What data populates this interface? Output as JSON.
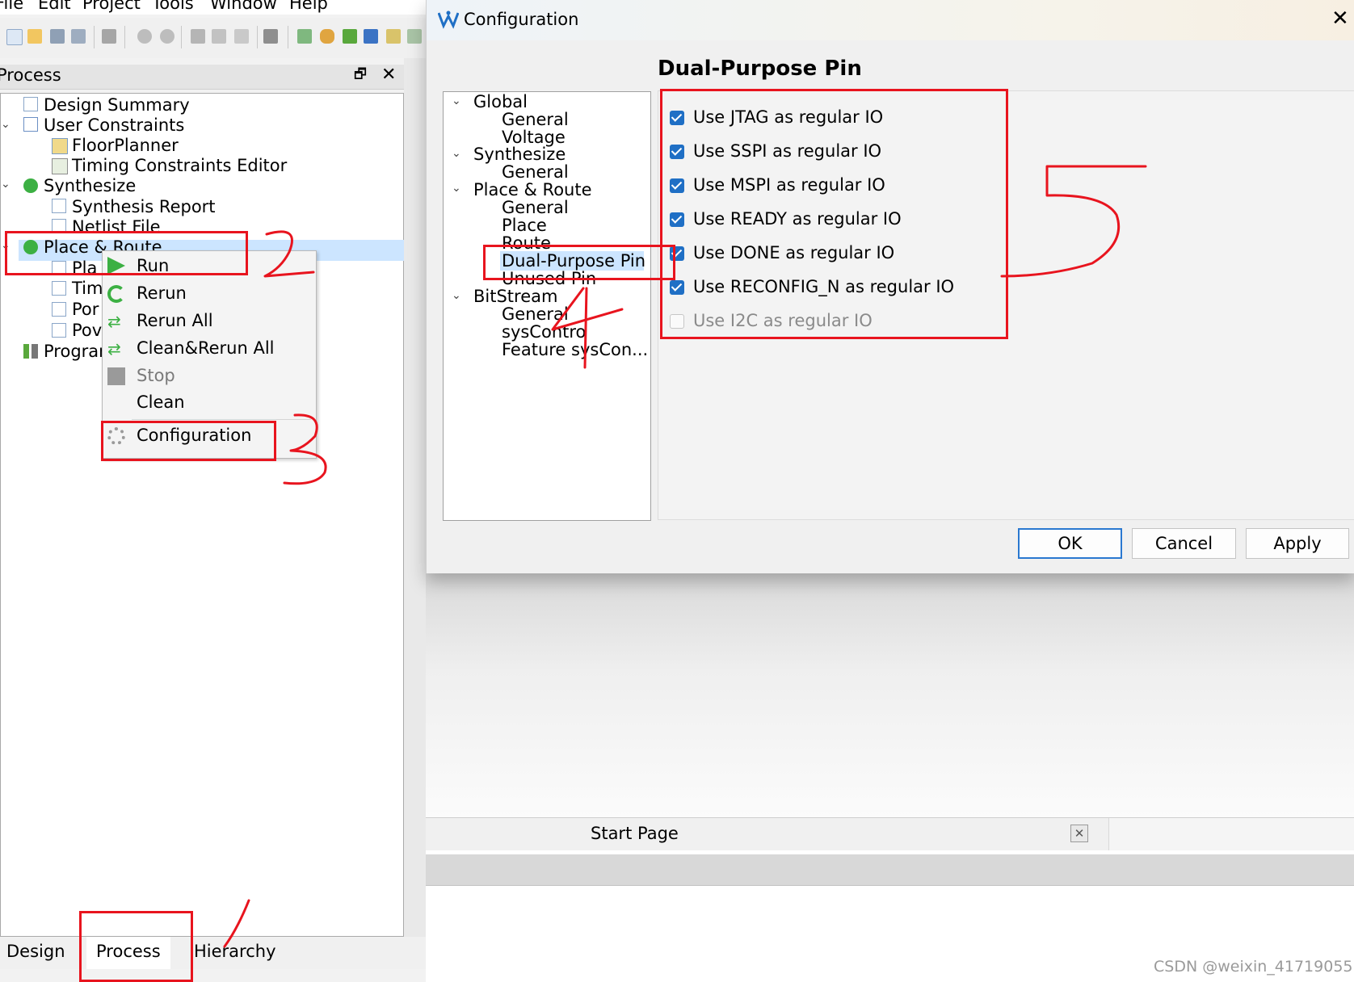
{
  "menubar": {
    "items": [
      "File",
      "Edit",
      "Project",
      "Tools",
      "Window",
      "Help"
    ]
  },
  "process_panel": {
    "title": "Process",
    "tree": {
      "design_summary": "Design Summary",
      "user_constraints": "User Constraints",
      "floorplanner": "FloorPlanner",
      "timing_editor": "Timing Constraints Editor",
      "synthesize": "Synthesize",
      "synthesis_report": "Synthesis Report",
      "netlist_file": "Netlist File",
      "place_route": "Place & Route",
      "pr_child_1": "Pla",
      "pr_child_2": "Tim",
      "pr_child_3": "Por",
      "pr_child_4": "Pov",
      "program": "Program"
    }
  },
  "context_menu": {
    "run": "Run",
    "rerun": "Rerun",
    "rerun_all": "Rerun All",
    "clean_rerun_all": "Clean&Rerun All",
    "stop": "Stop",
    "clean": "Clean",
    "configuration": "Configuration"
  },
  "bottom_tabs": {
    "design": "Design",
    "process": "Process",
    "hierarchy": "Hierarchy"
  },
  "dialog": {
    "title": "Configuration",
    "heading": "Dual-Purpose Pin",
    "tree": {
      "global": "Global",
      "global_general": "General",
      "global_voltage": "Voltage",
      "synthesize": "Synthesize",
      "synth_general": "General",
      "place_route": "Place & Route",
      "pr_general": "General",
      "pr_place": "Place",
      "pr_route": "Route",
      "pr_dual_purpose": "Dual-Purpose Pin",
      "pr_unused": "Unused Pin",
      "bitstream": "BitStream",
      "bs_general": "General",
      "bs_syscontrol": "sysContro",
      "bs_feature": "Feature sysCon..."
    },
    "options": [
      {
        "label": "Use JTAG as regular IO",
        "checked": true,
        "enabled": true
      },
      {
        "label": "Use SSPI as regular IO",
        "checked": true,
        "enabled": true
      },
      {
        "label": "Use MSPI as regular IO",
        "checked": true,
        "enabled": true
      },
      {
        "label": "Use READY as regular IO",
        "checked": true,
        "enabled": true
      },
      {
        "label": "Use DONE as regular IO",
        "checked": true,
        "enabled": true
      },
      {
        "label": "Use RECONFIG_N as regular IO",
        "checked": true,
        "enabled": true
      },
      {
        "label": "Use I2C as regular IO",
        "checked": false,
        "enabled": false
      }
    ],
    "buttons": {
      "ok": "OK",
      "cancel": "Cancel",
      "apply": "Apply"
    }
  },
  "start_page": {
    "label": "Start Page"
  },
  "watermark": "CSDN @weixin_41719055",
  "colors": {
    "annotation_red": "#e8141e",
    "selection": "#cce5ff",
    "checkbox_blue": "#1f6fc5"
  }
}
